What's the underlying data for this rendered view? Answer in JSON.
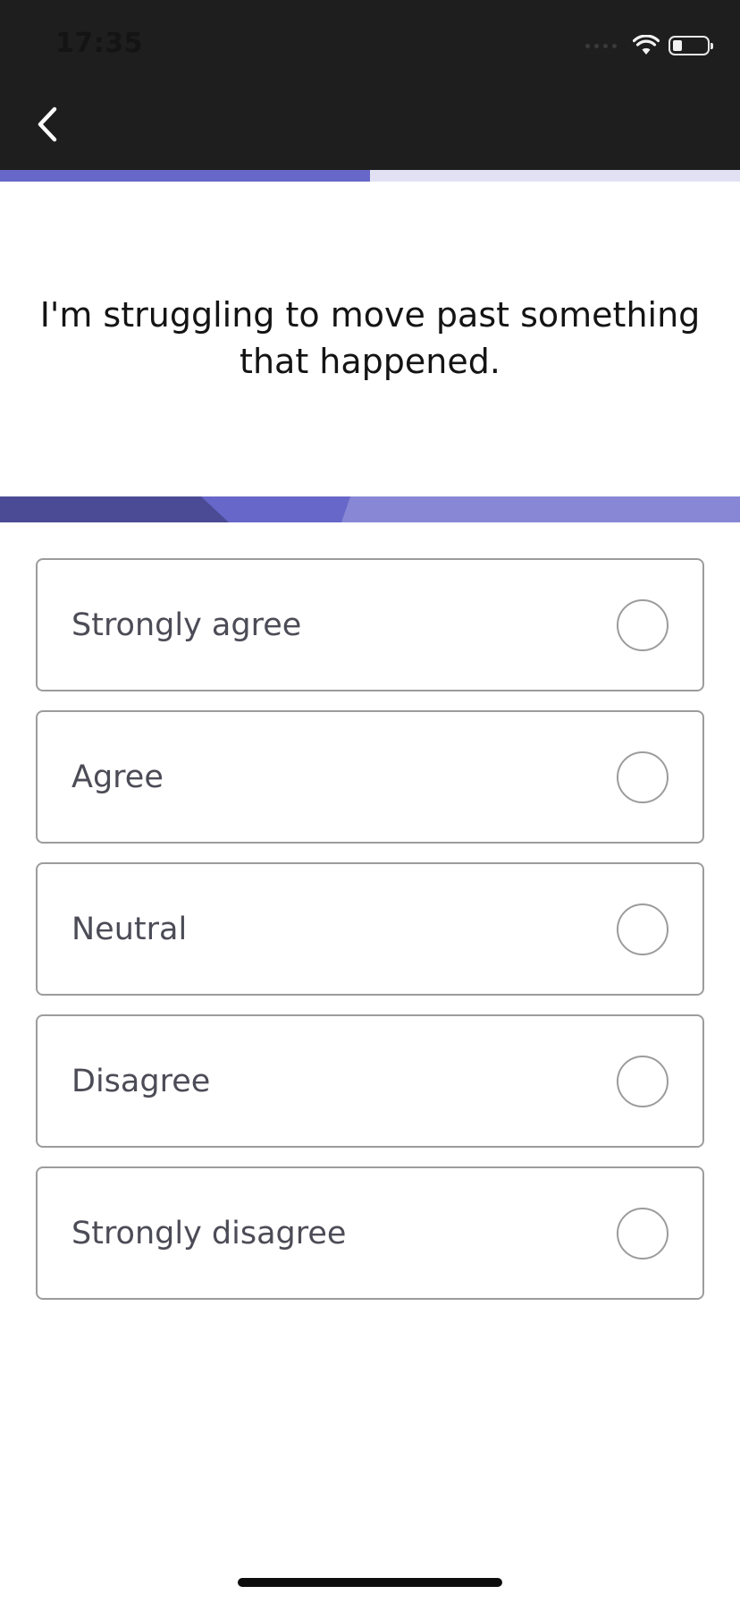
{
  "status_bar": {
    "time": "17:35",
    "icons": [
      "cellular-signal-icon",
      "wifi-icon",
      "battery-icon"
    ]
  },
  "nav": {
    "back_icon": "chevron-left-icon"
  },
  "progress": {
    "fraction": 0.5,
    "fill_color": "#6767c9",
    "track_color": "#e2e1f4"
  },
  "question": {
    "text": "I'm struggling to move past something that happened."
  },
  "options": [
    {
      "label": "Strongly agree",
      "selected": false
    },
    {
      "label": "Agree",
      "selected": false
    },
    {
      "label": "Neutral",
      "selected": false
    },
    {
      "label": "Disagree",
      "selected": false
    },
    {
      "label": "Strongly disagree",
      "selected": false
    }
  ],
  "colors": {
    "header_bg": "#1e1e1e",
    "accent": "#6767c9",
    "banner_dark": "#4b4b95",
    "banner_light": "#8787d6",
    "option_border": "#9c9c9c",
    "option_text": "#4c4c57"
  }
}
